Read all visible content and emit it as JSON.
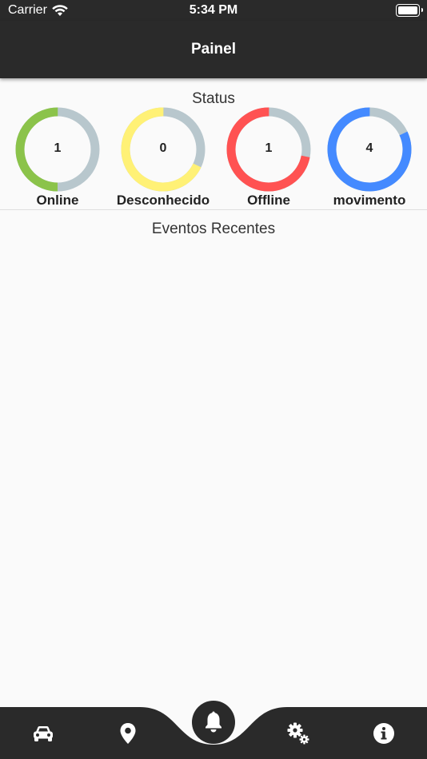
{
  "statusbar": {
    "carrier": "Carrier",
    "time": "5:34 PM"
  },
  "appbar": {
    "title": "Painel"
  },
  "status": {
    "title": "Status",
    "gauges": [
      {
        "label": "Online",
        "value": "1",
        "fraction": 0.5,
        "color": "#8bc34a"
      },
      {
        "label": "Desconhecido",
        "value": "0",
        "fraction": 0.68,
        "color": "#fff176"
      },
      {
        "label": "Offline",
        "value": "1",
        "fraction": 0.72,
        "color": "#ff5252"
      },
      {
        "label": "movimento",
        "value": "4",
        "fraction": 0.82,
        "color": "#448aff"
      }
    ],
    "track_color": "#b8c7cd"
  },
  "events": {
    "title": "Eventos Recentes"
  },
  "nav": {
    "items": [
      {
        "icon": "car-icon"
      },
      {
        "icon": "map-pin-icon"
      },
      {
        "icon": "bell-icon"
      },
      {
        "icon": "gears-icon"
      },
      {
        "icon": "info-icon"
      }
    ]
  }
}
